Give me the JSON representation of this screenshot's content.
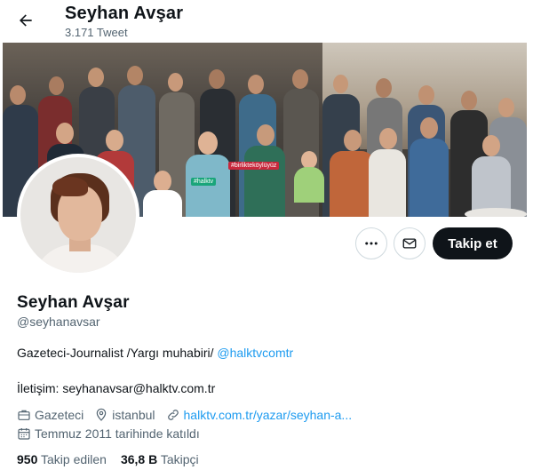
{
  "header": {
    "name": "Seyhan Avşar",
    "tweet_count": "3.171 Tweet"
  },
  "banner": {
    "sign_texts": [
      "#birlikteköylüyüz",
      "#halktv"
    ]
  },
  "actions": {
    "more_icon": "more-icon",
    "message_icon": "envelope-icon",
    "follow_label": "Takip et"
  },
  "profile": {
    "name": "Seyhan Avşar",
    "handle": "@seyhanavsar",
    "bio_text": "Gazeteci-Journalist /Yargı muhabiri/ ",
    "bio_mention": "@halktvcomtr",
    "contact": "İletişim: seyhanavsar@halktv.com.tr",
    "category": "Gazeteci",
    "location": "istanbul",
    "website": "halktv.com.tr/yazar/seyhan-a...",
    "joined": "Temmuz 2011 tarihinde katıldı"
  },
  "stats": {
    "following_count": "950",
    "following_label": "Takip edilen",
    "followers_count": "36,8 B",
    "followers_label": "Takipçi"
  },
  "colors": {
    "accent": "#1d9bf0",
    "text": "#0f1419",
    "secondary": "#536471",
    "follow_bg": "#0f1419"
  }
}
